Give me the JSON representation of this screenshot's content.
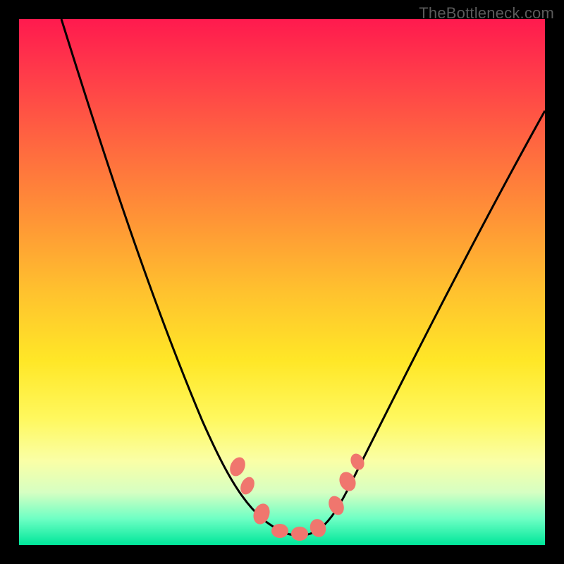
{
  "watermark": "TheBottleneck.com",
  "chart_data": {
    "type": "line",
    "title": "",
    "xlabel": "",
    "ylabel": "",
    "xlim": [
      0,
      100
    ],
    "ylim": [
      0,
      100
    ],
    "series": [
      {
        "name": "bottleneck-curve",
        "x": [
          8,
          12,
          18,
          24,
          30,
          35,
          38,
          41,
          44,
          47,
          50,
          53,
          56,
          58,
          62,
          68,
          76,
          84,
          92,
          100
        ],
        "y": [
          100,
          90,
          76,
          62,
          48,
          36,
          28,
          20,
          12,
          6,
          3,
          2,
          3,
          6,
          14,
          28,
          46,
          62,
          76,
          88
        ]
      }
    ],
    "markers": {
      "name": "highlight-nodes",
      "x": [
        41,
        43,
        46,
        50,
        54,
        57,
        58,
        59
      ],
      "y": [
        20,
        14,
        6,
        3,
        3,
        6,
        12,
        16
      ]
    },
    "background_gradient": {
      "top": "#ff1a4e",
      "mid": "#ffe727",
      "bottom": "#00e69a"
    }
  }
}
